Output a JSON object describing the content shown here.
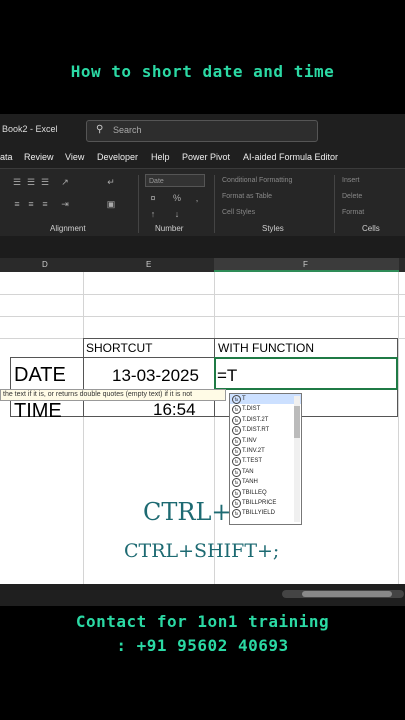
{
  "caption": "How to short date and time",
  "window": {
    "doc_title": "Book2 - Excel",
    "search_placeholder": "Search"
  },
  "menu": [
    "ata",
    "Review",
    "View",
    "Developer",
    "Help",
    "Power Pivot",
    "AI-aided Formula Editor"
  ],
  "ribbon": {
    "number_format": "Date",
    "groups": [
      "Alignment",
      "Number",
      "Styles",
      "Cells"
    ],
    "styles_items": [
      "Conditional Formatting",
      "Format as Table",
      "Cell Styles"
    ],
    "cells_items": [
      "Insert",
      "Delete",
      "Format"
    ]
  },
  "columns": [
    "D",
    "E",
    "F"
  ],
  "table": {
    "header_shortcut": "SHORTCUT",
    "header_function": "WITH FUNCTION",
    "row1_label": "DATE",
    "row1_value": "13-03-2025",
    "row1_formula": "=T",
    "row2_label": "TIME",
    "row2_value": "16:54"
  },
  "tooltip": "the text if it is, or returns double quotes (empty text) if it is not",
  "autocomplete": [
    "T",
    "T.DIST",
    "T.DIST.2T",
    "T.DIST.RT",
    "T.INV",
    "T.INV.2T",
    "T.TEST",
    "TAN",
    "TANH",
    "TBILLEQ",
    "TBILLPRICE",
    "TBILLYIELD"
  ],
  "overlay": {
    "line1": "CTRL+;",
    "line2": "CTRL+SHIFT+;"
  },
  "contact": {
    "line1": "Contact for 1on1 training",
    "line2": ": +91 95602 40693"
  },
  "colors": {
    "accent": "#2bd9a4",
    "overlay_text": "#1d6a72",
    "active_border": "#1f7a45"
  }
}
